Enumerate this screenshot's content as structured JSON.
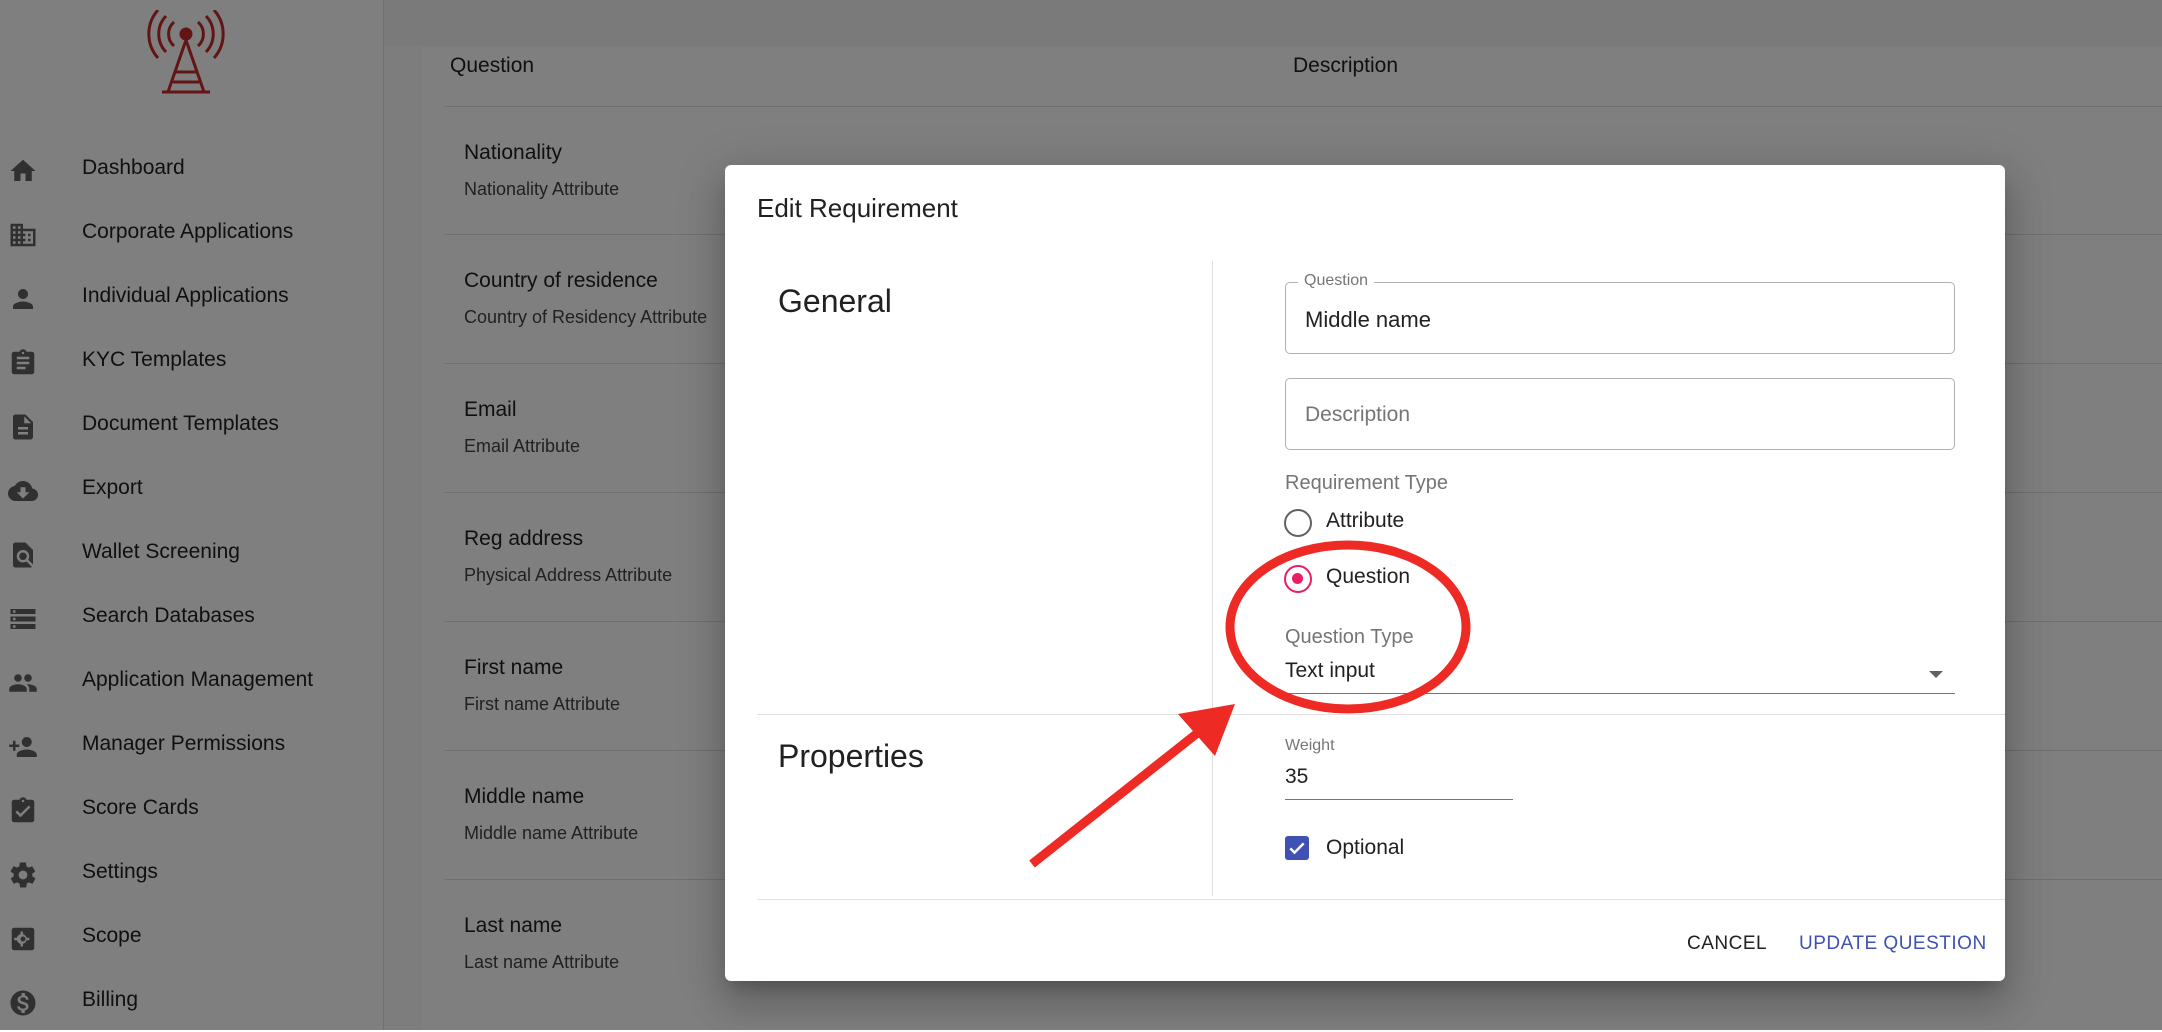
{
  "sidebar": {
    "items": [
      {
        "label": "Dashboard",
        "icon": "home-icon"
      },
      {
        "label": "Corporate Applications",
        "icon": "building-icon"
      },
      {
        "label": "Individual Applications",
        "icon": "person-icon"
      },
      {
        "label": "KYC Templates",
        "icon": "clipboard-icon"
      },
      {
        "label": "Document Templates",
        "icon": "document-icon"
      },
      {
        "label": "Export",
        "icon": "cloud-download-icon"
      },
      {
        "label": "Wallet Screening",
        "icon": "search-document-icon"
      },
      {
        "label": "Search Databases",
        "icon": "storage-icon"
      },
      {
        "label": "Application Management",
        "icon": "people-icon"
      },
      {
        "label": "Manager Permissions",
        "icon": "person-add-icon"
      },
      {
        "label": "Score Cards",
        "icon": "assignment-check-icon"
      },
      {
        "label": "Settings",
        "icon": "gear-icon"
      },
      {
        "label": "Scope",
        "icon": "scope-icon"
      },
      {
        "label": "Billing",
        "icon": "dollar-icon"
      }
    ]
  },
  "table": {
    "headers": {
      "question": "Question",
      "description": "Description"
    },
    "rows": [
      {
        "question": "Nationality",
        "description": "Nationality Attribute"
      },
      {
        "question": "Country of residence",
        "description": "Country of Residency Attribute"
      },
      {
        "question": "Email",
        "description": "Email Attribute"
      },
      {
        "question": "Reg address",
        "description": "Physical Address Attribute"
      },
      {
        "question": "First name",
        "description": "First name Attribute"
      },
      {
        "question": "Middle name",
        "description": "Middle name Attribute"
      },
      {
        "question": "Last name",
        "description": "Last name Attribute"
      }
    ]
  },
  "dialog": {
    "title": "Edit Requirement",
    "general_title": "General",
    "properties_title": "Properties",
    "question_label": "Question",
    "question_value": "Middle name",
    "description_placeholder": "Description",
    "requirement_type_label": "Requirement Type",
    "radio_attribute": "Attribute",
    "radio_question": "Question",
    "selected_type": "Question",
    "question_type_label": "Question Type",
    "question_type_value": "Text input",
    "weight_label": "Weight",
    "weight_value": "35",
    "optional_label": "Optional",
    "optional_checked": true,
    "cancel_label": "CANCEL",
    "update_label": "UPDATE QUESTION"
  },
  "colors": {
    "accent_primary": "#3f51b5",
    "radio_selected": "#e91e63",
    "annotation_red": "#ee2a24",
    "logo_red": "#c62828"
  }
}
